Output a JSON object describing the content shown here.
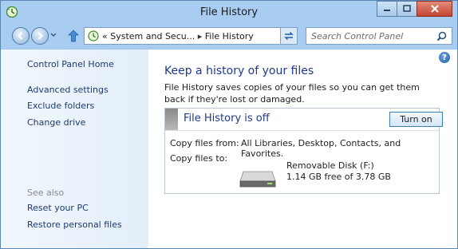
{
  "window": {
    "title": "File History"
  },
  "address": {
    "overflow": "«",
    "crumbs": [
      "System and Secu...",
      "File History"
    ],
    "separator": "▸"
  },
  "search": {
    "placeholder": "Search Control Panel"
  },
  "sidebar": {
    "items": [
      "Control Panel Home",
      "Advanced settings",
      "Exclude folders",
      "Change drive"
    ],
    "see_also_label": "See also",
    "see_also": [
      "Reset your PC",
      "Restore personal files"
    ]
  },
  "main": {
    "heading": "Keep a history of your files",
    "description": "File History saves copies of your files so you can get them back if they're lost or damaged.",
    "status": "File History is off",
    "turn_on_label": "Turn on",
    "copy_from_label": "Copy files from:",
    "copy_from_value": "All Libraries, Desktop, Contacts, and Favorites.",
    "copy_to_label": "Copy files to:",
    "drive_name": "Removable Disk (F:)",
    "drive_free": "1.14 GB free of 3.78 GB"
  },
  "icons": {
    "app": "file-history-icon",
    "back": "back-arrow-icon",
    "forward": "forward-arrow-icon",
    "up": "up-arrow-icon",
    "refresh": "refresh-icon",
    "search": "search-icon",
    "help": "help-icon",
    "drive": "removable-disk-icon"
  },
  "colors": {
    "accent": "#1e3a8a",
    "chrome": "#a8cdf0",
    "close": "#c44532"
  }
}
